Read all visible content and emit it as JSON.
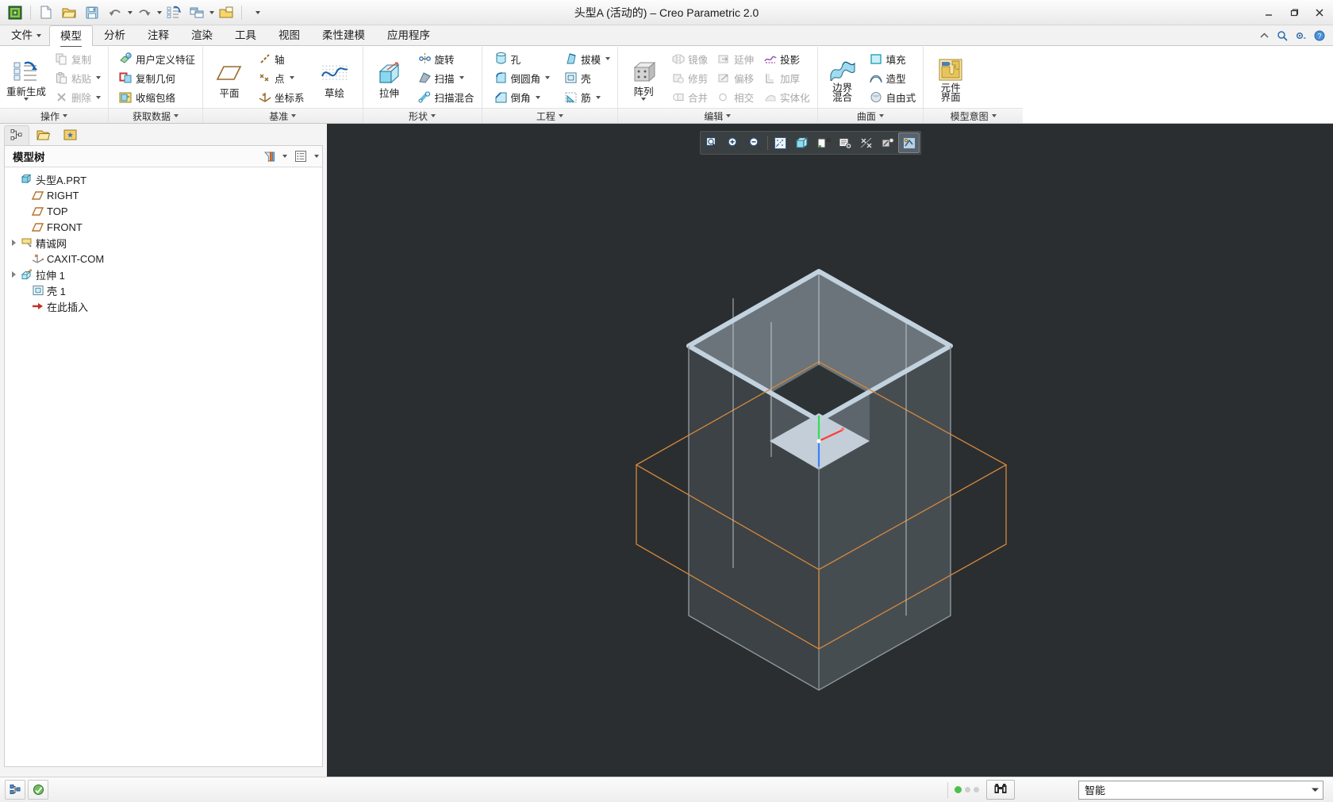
{
  "window": {
    "title": "头型A (活动的) – Creo Parametric 2.0",
    "minimize": "—",
    "restore": "❐",
    "close": "✕"
  },
  "quick_access": {
    "items": [
      {
        "name": "creo-logo-icon",
        "label": ""
      },
      {
        "name": "new-file-icon",
        "label": ""
      },
      {
        "name": "open-file-icon",
        "label": ""
      },
      {
        "name": "save-icon",
        "label": ""
      },
      {
        "name": "undo-icon",
        "label": ""
      },
      {
        "name": "redo-icon",
        "label": ""
      },
      {
        "name": "regenerate-icon",
        "label": ""
      },
      {
        "name": "window-switch-icon",
        "label": ""
      },
      {
        "name": "close-window-icon",
        "label": ""
      },
      {
        "name": "customize-qat-icon",
        "label": ""
      }
    ]
  },
  "tabs": [
    {
      "label": "文件",
      "has_caret": true,
      "active": false
    },
    {
      "label": "模型",
      "has_caret": false,
      "active": true
    },
    {
      "label": "分析",
      "has_caret": false,
      "active": false
    },
    {
      "label": "注释",
      "has_caret": false,
      "active": false
    },
    {
      "label": "渲染",
      "has_caret": false,
      "active": false
    },
    {
      "label": "工具",
      "has_caret": false,
      "active": false
    },
    {
      "label": "视图",
      "has_caret": false,
      "active": false
    },
    {
      "label": "柔性建模",
      "has_caret": false,
      "active": false
    },
    {
      "label": "应用程序",
      "has_caret": false,
      "active": false
    }
  ],
  "tab_right_icons": [
    {
      "name": "minimize-ribbon-icon"
    },
    {
      "name": "search-icon"
    },
    {
      "name": "settings-icon"
    },
    {
      "name": "help-icon"
    }
  ],
  "ribbon": {
    "groups": [
      {
        "name": "操作",
        "big": [
          {
            "label": "重新生成",
            "icon": "regenerate-icon",
            "has_caret": true
          }
        ],
        "small": [
          {
            "label": "复制",
            "icon": "copy-icon",
            "disabled": true,
            "caret": false
          },
          {
            "label": "粘贴",
            "icon": "paste-icon",
            "disabled": true,
            "caret": true
          },
          {
            "label": "删除",
            "icon": "delete-icon",
            "disabled": true,
            "caret": true
          }
        ]
      },
      {
        "name": "获取数据",
        "big": [],
        "small": [
          {
            "label": "用户定义特征",
            "icon": "udf-icon",
            "disabled": false,
            "caret": false
          },
          {
            "label": "复制几何",
            "icon": "copy-geometry-icon",
            "disabled": false,
            "caret": false
          },
          {
            "label": "收缩包络",
            "icon": "shrinkwrap-icon",
            "disabled": false,
            "caret": false
          }
        ]
      },
      {
        "name": "基准",
        "big": [
          {
            "label": "平面",
            "icon": "datum-plane-icon",
            "has_caret": false
          },
          {
            "label": "草绘",
            "icon": "sketch-icon",
            "has_caret": false
          }
        ],
        "small": [
          {
            "label": "轴",
            "icon": "datum-axis-icon",
            "disabled": false,
            "caret": false
          },
          {
            "label": "点",
            "icon": "datum-point-icon",
            "disabled": false,
            "caret": true
          },
          {
            "label": "坐标系",
            "icon": "coordinate-system-icon",
            "disabled": false,
            "caret": false
          }
        ]
      },
      {
        "name": "形状",
        "big": [
          {
            "label": "拉伸",
            "icon": "extrude-icon",
            "has_caret": false
          }
        ],
        "small": [
          {
            "label": "旋转",
            "icon": "revolve-icon",
            "disabled": false,
            "caret": false
          },
          {
            "label": "扫描",
            "icon": "sweep-icon",
            "disabled": false,
            "caret": true
          },
          {
            "label": "扫描混合",
            "icon": "swept-blend-icon",
            "disabled": false,
            "caret": false
          }
        ]
      },
      {
        "name": "工程",
        "big": [],
        "small_cols": [
          [
            {
              "label": "孔",
              "icon": "hole-icon",
              "disabled": false,
              "caret": false
            },
            {
              "label": "倒圆角",
              "icon": "round-icon",
              "disabled": false,
              "caret": true
            },
            {
              "label": "倒角",
              "icon": "chamfer-icon",
              "disabled": false,
              "caret": true
            }
          ],
          [
            {
              "label": "拔模",
              "icon": "draft-icon",
              "disabled": false,
              "caret": true
            },
            {
              "label": "壳",
              "icon": "shell-icon",
              "disabled": false,
              "caret": false
            },
            {
              "label": "筋",
              "icon": "rib-icon",
              "disabled": false,
              "caret": true
            }
          ]
        ]
      },
      {
        "name": "编辑",
        "big": [
          {
            "label": "阵列",
            "icon": "pattern-icon",
            "has_caret": true
          }
        ],
        "small_cols": [
          [
            {
              "label": "镜像",
              "icon": "mirror-icon",
              "disabled": true,
              "caret": false
            },
            {
              "label": "修剪",
              "icon": "trim-icon",
              "disabled": true,
              "caret": false
            },
            {
              "label": "合并",
              "icon": "merge-icon",
              "disabled": true,
              "caret": false
            }
          ],
          [
            {
              "label": "延伸",
              "icon": "extend-icon",
              "disabled": true,
              "caret": false
            },
            {
              "label": "偏移",
              "icon": "offset-icon",
              "disabled": true,
              "caret": false
            },
            {
              "label": "相交",
              "icon": "intersect-icon",
              "disabled": true,
              "caret": false
            }
          ],
          [
            {
              "label": "投影",
              "icon": "project-icon",
              "disabled": false,
              "caret": false
            },
            {
              "label": "加厚",
              "icon": "thicken-icon",
              "disabled": true,
              "caret": false
            },
            {
              "label": "实体化",
              "icon": "solidify-icon",
              "disabled": true,
              "caret": false
            }
          ]
        ]
      },
      {
        "name": "曲面",
        "big": [
          {
            "label": "边界",
            "label2": "混合",
            "icon": "boundary-blend-icon",
            "has_caret": false
          }
        ],
        "small": [
          {
            "label": "填充",
            "icon": "fill-icon",
            "disabled": false,
            "caret": false
          },
          {
            "label": "造型",
            "icon": "style-icon",
            "disabled": false,
            "caret": false
          },
          {
            "label": "自由式",
            "icon": "freestyle-icon",
            "disabled": false,
            "caret": false
          }
        ]
      },
      {
        "name": "模型意图",
        "big": [
          {
            "label": "元件",
            "label2": "界面",
            "icon": "component-interface-icon",
            "has_caret": false
          }
        ],
        "small": []
      }
    ]
  },
  "navigator": {
    "tabs": [
      {
        "name": "model-tree-tab",
        "icon": "model-tree-icon",
        "active": true
      },
      {
        "name": "folder-browser-tab",
        "icon": "folder-browser-icon",
        "active": false
      },
      {
        "name": "favorites-tab",
        "icon": "favorites-folder-icon",
        "active": false
      }
    ],
    "panel_title": "模型树",
    "header_buttons": [
      {
        "name": "tree-filter-button",
        "icon": "filter-icon",
        "caret": true
      },
      {
        "name": "tree-settings-button",
        "icon": "list-settings-icon",
        "caret": true
      }
    ],
    "tree": [
      {
        "label": "头型A.PRT",
        "icon": "part-icon",
        "indent": 0,
        "expander": false
      },
      {
        "label": "RIGHT",
        "icon": "datum-plane-icon",
        "indent": 1,
        "expander": false
      },
      {
        "label": "TOP",
        "icon": "datum-plane-icon",
        "indent": 1,
        "expander": false
      },
      {
        "label": "FRONT",
        "icon": "datum-plane-icon",
        "indent": 1,
        "expander": false
      },
      {
        "label": "精诚网",
        "icon": "datum-plane-yellow-icon",
        "indent": 1,
        "expander": true
      },
      {
        "label": "CAXIT-COM",
        "icon": "coordinate-system-icon",
        "indent": 1,
        "expander": false
      },
      {
        "label": "拉伸 1",
        "icon": "extrude-feature-icon",
        "indent": 1,
        "expander": true
      },
      {
        "label": "壳 1",
        "icon": "shell-feature-icon",
        "indent": 1,
        "expander": false
      },
      {
        "label": "在此插入",
        "icon": "insert-here-icon",
        "indent": 1,
        "expander": false
      }
    ]
  },
  "graphics_toolbar": [
    {
      "name": "refit-button",
      "icon": "refit-icon"
    },
    {
      "name": "zoom-in-button",
      "icon": "zoom-in-icon"
    },
    {
      "name": "zoom-out-button",
      "icon": "zoom-out-icon"
    },
    {
      "name": "datum-display-button",
      "icon": "datum-display-icon"
    },
    {
      "name": "display-style-button",
      "icon": "display-style-icon"
    },
    {
      "name": "annotation-display-button",
      "icon": "annotation-display-icon"
    },
    {
      "name": "saved-views-button",
      "icon": "saved-views-icon"
    },
    {
      "name": "spin-center-button",
      "icon": "spin-center-icon"
    },
    {
      "name": "appearance-gallery-button",
      "icon": "appearance-gallery-icon"
    },
    {
      "name": "view-manager-button",
      "icon": "view-manager-icon"
    }
  ],
  "status_bar": {
    "left_buttons": [
      {
        "name": "selection-filter-button",
        "icon": "selection-filter-icon"
      },
      {
        "name": "model-colors-button",
        "icon": "model-colors-icon"
      }
    ],
    "status_dots": [
      {
        "name": "status-dot-active",
        "color": "#49c24a"
      },
      {
        "name": "status-dot-idle-1",
        "color": "#c9c9c9"
      },
      {
        "name": "status-dot-idle-2",
        "color": "#c9c9c9"
      }
    ],
    "search_button": {
      "name": "search-tool-button",
      "icon": "binoculars-icon"
    },
    "selection_filter": {
      "value": "智能",
      "caret": "▼"
    }
  },
  "colors": {
    "graphics_background": "#2a2e30",
    "model_face_dark": "#42484b",
    "model_face_light": "#5b6367",
    "model_edge_highlight": "#c3d2df",
    "datum_plane_orange": "#d4883c",
    "csys_red": "#ff3a3a",
    "csys_green": "#33dd55",
    "csys_blue": "#3a7fff",
    "cavity_floor": "#c8d2da",
    "accent_blue": "#3b7cc4"
  }
}
